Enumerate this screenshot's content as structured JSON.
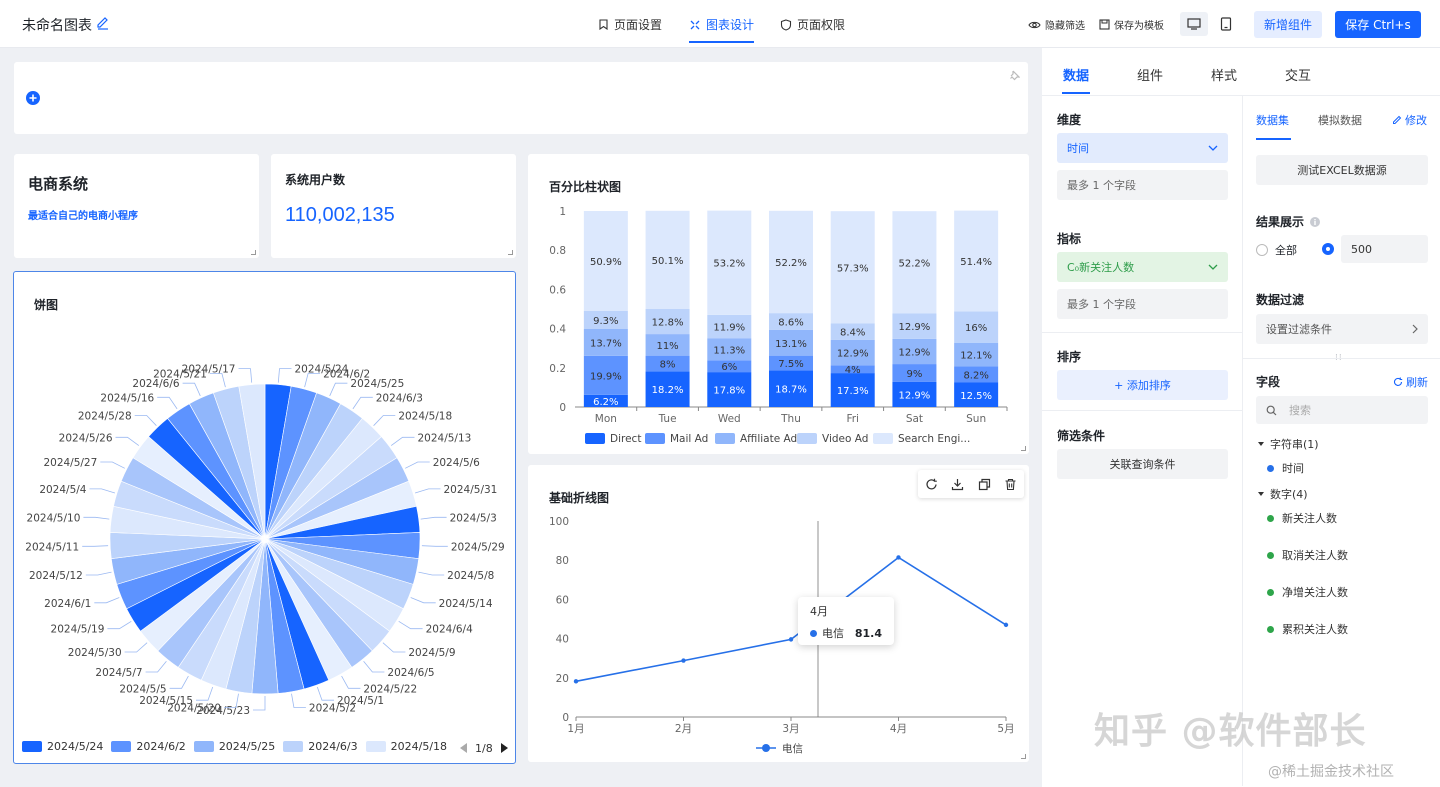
{
  "header": {
    "title": "未命名图表",
    "tabs": [
      {
        "label": "页面设置",
        "icon": "bookmark-icon"
      },
      {
        "label": "图表设计",
        "icon": "design-icon"
      },
      {
        "label": "页面权限",
        "icon": "shield-icon"
      }
    ],
    "hide_filter": "隐藏筛选",
    "save_template": "保存为模板",
    "add_component": "新增组件",
    "save": "保存 Ctrl+s"
  },
  "colors": {
    "accent": "#1664ff",
    "blues": [
      "#1664ff",
      "#5d93ff",
      "#90b6fb",
      "#bcd3fb",
      "#dce8fd"
    ]
  },
  "cards": {
    "ecommerce": {
      "title": "电商系统",
      "subtitle": "最适合自己的电商小程序"
    },
    "users": {
      "title": "系统用户数",
      "value": "110,002,135"
    },
    "pie": {
      "title": "饼图",
      "page": "1/8"
    },
    "stacked": {
      "title": "百分比柱状图"
    },
    "line": {
      "title": "基础折线图"
    }
  },
  "chart_data": [
    {
      "type": "pie",
      "title": "饼图",
      "slices": [
        {
          "label": "2024/5/24",
          "value": 1
        },
        {
          "label": "2024/6/2",
          "value": 1
        },
        {
          "label": "2024/5/25",
          "value": 1
        },
        {
          "label": "2024/6/3",
          "value": 1
        },
        {
          "label": "2024/5/18",
          "value": 1
        },
        {
          "label": "2024/5/13",
          "value": 1
        },
        {
          "label": "2024/5/6",
          "value": 1
        },
        {
          "label": "2024/5/31",
          "value": 1
        },
        {
          "label": "2024/5/3",
          "value": 1
        },
        {
          "label": "2024/5/29",
          "value": 1
        },
        {
          "label": "2024/5/8",
          "value": 1
        },
        {
          "label": "2024/5/14",
          "value": 1
        },
        {
          "label": "2024/6/4",
          "value": 1
        },
        {
          "label": "2024/5/9",
          "value": 1
        },
        {
          "label": "2024/6/5",
          "value": 1
        },
        {
          "label": "2024/5/22",
          "value": 1
        },
        {
          "label": "2024/5/1",
          "value": 1
        },
        {
          "label": "2024/5/2",
          "value": 1
        },
        {
          "label": "2024/5/23",
          "value": 1
        },
        {
          "label": "2024/5/20",
          "value": 1
        },
        {
          "label": "2024/5/15",
          "value": 1
        },
        {
          "label": "2024/5/5",
          "value": 1
        },
        {
          "label": "2024/5/7",
          "value": 1
        },
        {
          "label": "2024/5/30",
          "value": 1
        },
        {
          "label": "2024/5/19",
          "value": 1
        },
        {
          "label": "2024/6/1",
          "value": 1
        },
        {
          "label": "2024/5/12",
          "value": 1
        },
        {
          "label": "2024/5/11",
          "value": 1
        },
        {
          "label": "2024/5/10",
          "value": 1
        },
        {
          "label": "2024/5/4",
          "value": 1
        },
        {
          "label": "2024/5/27",
          "value": 1
        },
        {
          "label": "2024/5/26",
          "value": 1
        },
        {
          "label": "2024/5/28",
          "value": 1
        },
        {
          "label": "2024/5/16",
          "value": 1
        },
        {
          "label": "2024/6/6",
          "value": 1
        },
        {
          "label": "2024/5/21",
          "value": 1
        },
        {
          "label": "2024/5/17",
          "value": 1
        }
      ],
      "legend": [
        "2024/5/24",
        "2024/6/2",
        "2024/5/25",
        "2024/6/3",
        "2024/5/18"
      ]
    },
    {
      "type": "bar",
      "title": "百分比柱状图",
      "categories": [
        "Mon",
        "Tue",
        "Wed",
        "Thu",
        "Fri",
        "Sat",
        "Sun"
      ],
      "yticks": [
        "0",
        "0.2",
        "0.4",
        "0.6",
        "0.8",
        "1"
      ],
      "ylim": [
        0,
        1
      ],
      "series": [
        {
          "name": "Direct",
          "values": [
            6.2,
            18.2,
            17.8,
            18.7,
            17.3,
            12.9,
            12.5
          ]
        },
        {
          "name": "Mail Ad",
          "values": [
            19.9,
            8,
            6,
            7.5,
            4,
            9,
            8.2
          ]
        },
        {
          "name": "Affiliate Ad",
          "values": [
            13.7,
            11,
            11.3,
            13.1,
            12.9,
            12.9,
            12.1
          ]
        },
        {
          "name": "Video Ad",
          "values": [
            9.3,
            12.8,
            11.9,
            8.6,
            8.4,
            12.9,
            16
          ]
        },
        {
          "name": "Search Engi...",
          "values": [
            50.9,
            50.1,
            53.2,
            52.2,
            57.3,
            52.2,
            51.4
          ]
        }
      ]
    },
    {
      "type": "line",
      "title": "基础折线图",
      "categories": [
        "1月",
        "2月",
        "3月",
        "4月",
        "5月"
      ],
      "yticks": [
        "0",
        "20",
        "40",
        "60",
        "80",
        "100"
      ],
      "ylim": [
        0,
        100
      ],
      "series": [
        {
          "name": "电信",
          "values": [
            18.2,
            28.8,
            39.6,
            81.4,
            47
          ]
        }
      ],
      "tooltip": {
        "title": "4月",
        "name": "电信",
        "value": "81.4"
      }
    }
  ],
  "right_panel": {
    "tabs": [
      "数据",
      "组件",
      "样式",
      "交互"
    ],
    "dimension": {
      "label": "维度",
      "value": "时间",
      "hint": "最多 1 个字段"
    },
    "metric": {
      "label": "指标",
      "value": "C₀新关注人数",
      "hint": "最多 1 个字段"
    },
    "sort": {
      "label": "排序",
      "button": "+ 添加排序"
    },
    "filter": {
      "label": "筛选条件",
      "button": "关联查询条件"
    },
    "dataset_tabs": [
      "数据集",
      "模拟数据"
    ],
    "edit": "修改",
    "source": "测试EXCEL数据源",
    "result": {
      "label": "结果展示",
      "all": "全部",
      "limit": "500"
    },
    "data_filter": {
      "label": "数据过滤",
      "placeholder": "设置过滤条件"
    },
    "fields": {
      "label": "字段",
      "refresh": "刷新",
      "search_placeholder": "搜索",
      "string_group": "字符串(1)",
      "strings": [
        "时间"
      ],
      "number_group": "数字(4)",
      "numbers": [
        "新关注人数",
        "取消关注人数",
        "净增关注人数",
        "累积关注人数"
      ]
    }
  },
  "watermark": {
    "main": "知乎 @软件部长",
    "sub": "@稀土掘金技术社区"
  }
}
